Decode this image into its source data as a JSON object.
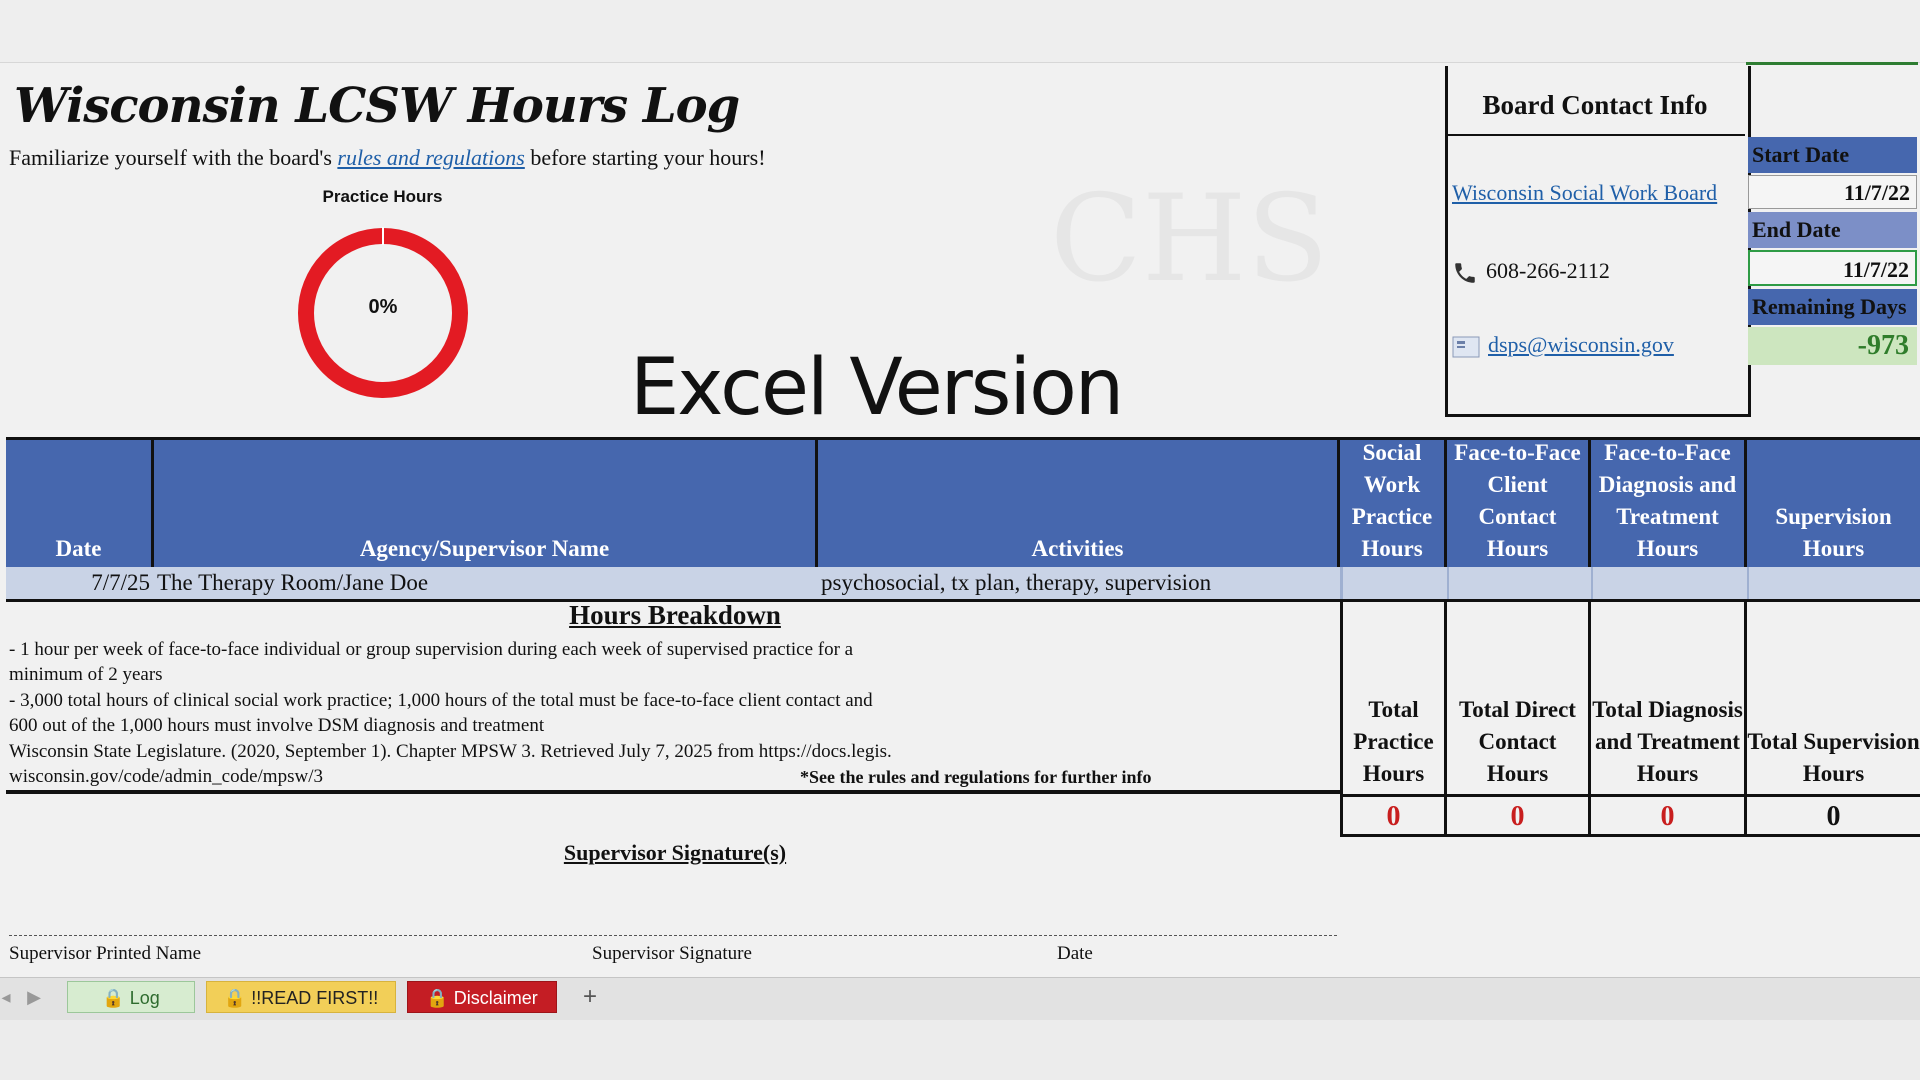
{
  "header": {
    "title": "Wisconsin LCSW Hours Log",
    "intro_before": "Familiarize yourself with the board's ",
    "intro_link": "rules and regulations",
    "intro_after": " before starting your hours!",
    "excel_version": "Excel Version"
  },
  "practice_chart": {
    "label": "Practice Hours",
    "percent_text": "0%",
    "percent_value": 0,
    "ring_color": "#e31b23"
  },
  "contact": {
    "heading": "Board Contact Info",
    "board_link": "Wisconsin Social Work Board",
    "phone": "608-266-2112",
    "email": "dsps@wisconsin.gov",
    "phone_icon": "phone-icon",
    "email_icon": "email-icon"
  },
  "dates": {
    "start_label": "Start Date",
    "start_value": "11/7/22",
    "end_label": "End Date",
    "end_value": "11/7/22",
    "remaining_label": "Remaining Days",
    "remaining_value": "-973"
  },
  "table": {
    "headers": [
      "Date",
      "Agency/Supervisor Name",
      "Activities",
      "Social Work Practice Hours",
      "Face-to-Face Client Contact Hours",
      "Face-to-Face Diagnosis and Treatment Hours",
      "Supervision Hours"
    ],
    "rows": [
      {
        "date": "7/7/25",
        "agency": "The Therapy Room/Jane Doe",
        "activities": "psychosocial, tx plan, therapy, supervision"
      }
    ],
    "header_color": "#4667ae"
  },
  "breakdown": {
    "title": "Hours Breakdown",
    "lines": [
      "- 1 hour per week of face-to-face individual or group supervision during each week of supervised practice for a",
      "minimum of 2 years",
      "- 3,000 total hours of clinical social work practice; 1,000 hours of the total must be face-to-face client contact and",
      "600 out of the 1,000 hours must involve DSM diagnosis and treatment",
      "Wisconsin State Legislature. (2020, September 1). Chapter MPSW 3. Retrieved July 7, 2025 from https://docs.legis.",
      "wisconsin.gov/code/admin_code/mpsw/3"
    ],
    "note": "*See the rules and regulations for further info"
  },
  "totals": {
    "labels": [
      "Total Practice Hours",
      "Total Direct Contact Hours",
      "Total Diagnosis and Treatment Hours",
      "Total Supervision Hours"
    ],
    "values": [
      "0",
      "0",
      "0",
      "0"
    ]
  },
  "signature": {
    "title": "Supervisor Signature(s)",
    "printed_name": "Supervisor Printed Name",
    "signature": "Supervisor Signature",
    "date": "Date"
  },
  "tabs": {
    "log": "Log",
    "read_first": "!!READ FIRST!!",
    "disclaimer": "Disclaimer",
    "add": "+"
  }
}
